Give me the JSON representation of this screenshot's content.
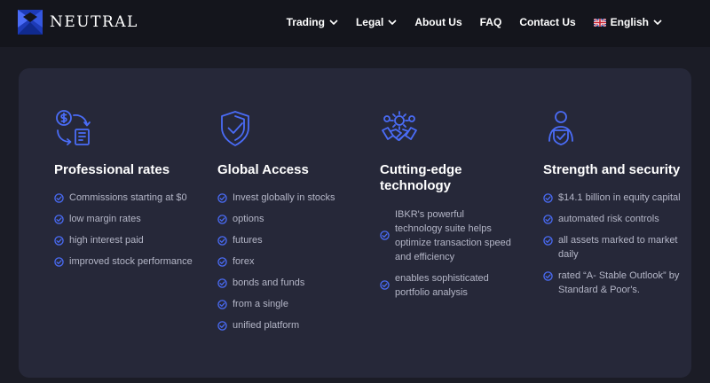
{
  "brand": {
    "name": "NEUTRAL"
  },
  "nav": {
    "items": [
      {
        "label": "Trading",
        "dropdown": true
      },
      {
        "label": "Legal",
        "dropdown": true
      },
      {
        "label": "About Us",
        "dropdown": false
      },
      {
        "label": "FAQ",
        "dropdown": false
      },
      {
        "label": "Contact Us",
        "dropdown": false
      }
    ],
    "language": {
      "label": "English",
      "flag": "uk-flag-icon"
    }
  },
  "colors": {
    "page_bg": "#1b1c26",
    "nav_bg": "#14151c",
    "panel_bg": "#262839",
    "accent": "#4a6cf7",
    "text_muted": "#b4b6c7"
  },
  "features": [
    {
      "icon": "dollar-exchange-icon",
      "title": "Professional rates",
      "items": [
        "Commissions starting at $0",
        "low margin rates",
        "high interest paid",
        "improved stock performance"
      ]
    },
    {
      "icon": "shield-check-icon",
      "title": "Global Access",
      "items": [
        "Invest globally in stocks",
        "options",
        "futures",
        "forex",
        "bonds and funds",
        "from a single",
        "unified platform"
      ]
    },
    {
      "icon": "handshake-gear-icon",
      "title_lines": [
        "Cutting-edge",
        "technology"
      ],
      "items": [
        "IBKR's powerful technology suite helps optimize transaction speed and efficiency",
        "enables sophisticated portfolio analysis"
      ]
    },
    {
      "icon": "secure-person-icon",
      "title": "Strength and security",
      "items": [
        "$14.1 billion in equity capital",
        "automated risk controls",
        "all assets marked to market daily",
        "rated “A- Stable Outlook” by Standard & Poor's."
      ]
    }
  ]
}
